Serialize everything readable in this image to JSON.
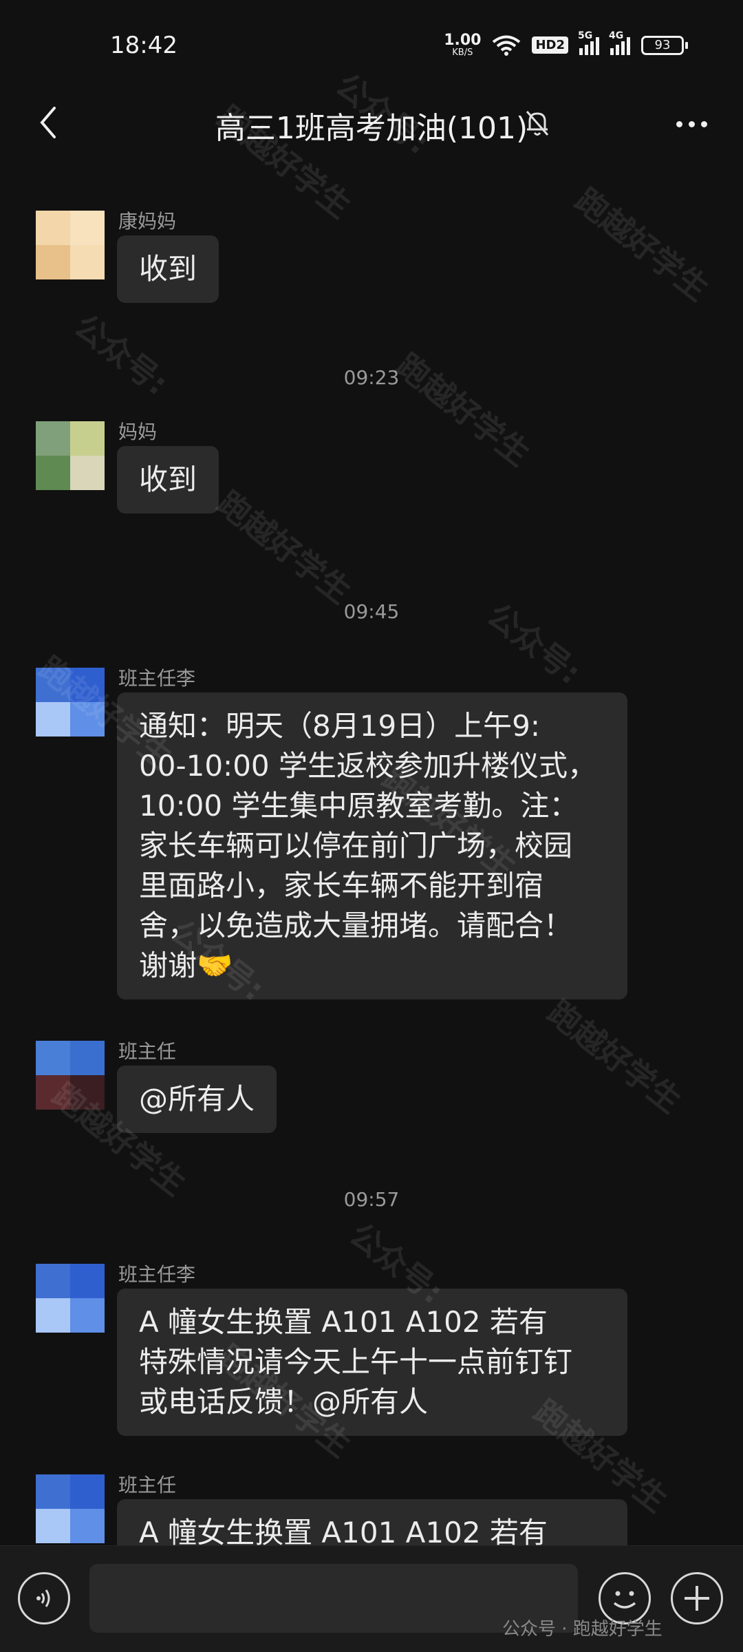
{
  "status_bar": {
    "time": "18:42",
    "net_speed_value": "1.00",
    "net_speed_unit": "KB/S",
    "hd_badge": "HD2",
    "signal_1": "5G",
    "signal_2": "4G",
    "battery": "93"
  },
  "header": {
    "title": "高三1班高考加油(101)",
    "muted": true
  },
  "timestamps": [
    "09:23",
    "09:45",
    "09:57"
  ],
  "messages": [
    {
      "sender": "康妈妈",
      "text": "收到"
    },
    {
      "sender": "妈妈",
      "text": "收到"
    },
    {
      "sender": "班主任李",
      "lines": [
        "通知：明天（8月19日）上午9:",
        "00-10:00 学生返校参加升楼仪式，",
        "10:00 学生集中原教室考勤。注：",
        "家长车辆可以停在前门广场，校园",
        "里面路小，家长车辆不能开到宿",
        "舍，以免造成大量拥堵。请配合！",
        "谢谢🤝"
      ]
    },
    {
      "sender": "班主任",
      "text": "@所有人"
    },
    {
      "sender": "班主任李",
      "lines": [
        "A 幢女生换置 A101   A102    若有",
        "特殊情况请今天上午十一点前钉钉",
        "或电话反馈！@所有人"
      ]
    },
    {
      "sender": "班主任",
      "text": "A 幢女生换置 A101   A102    若有"
    }
  ],
  "watermark": {
    "text_a": "公众号:",
    "text_b": "跑越好学生",
    "footer": "公众号 · 跑越好学生"
  },
  "colors": {
    "background": "#111111",
    "bubble": "#2b2b2b",
    "text": "#ececec",
    "muted_text": "#9a9a9a"
  }
}
